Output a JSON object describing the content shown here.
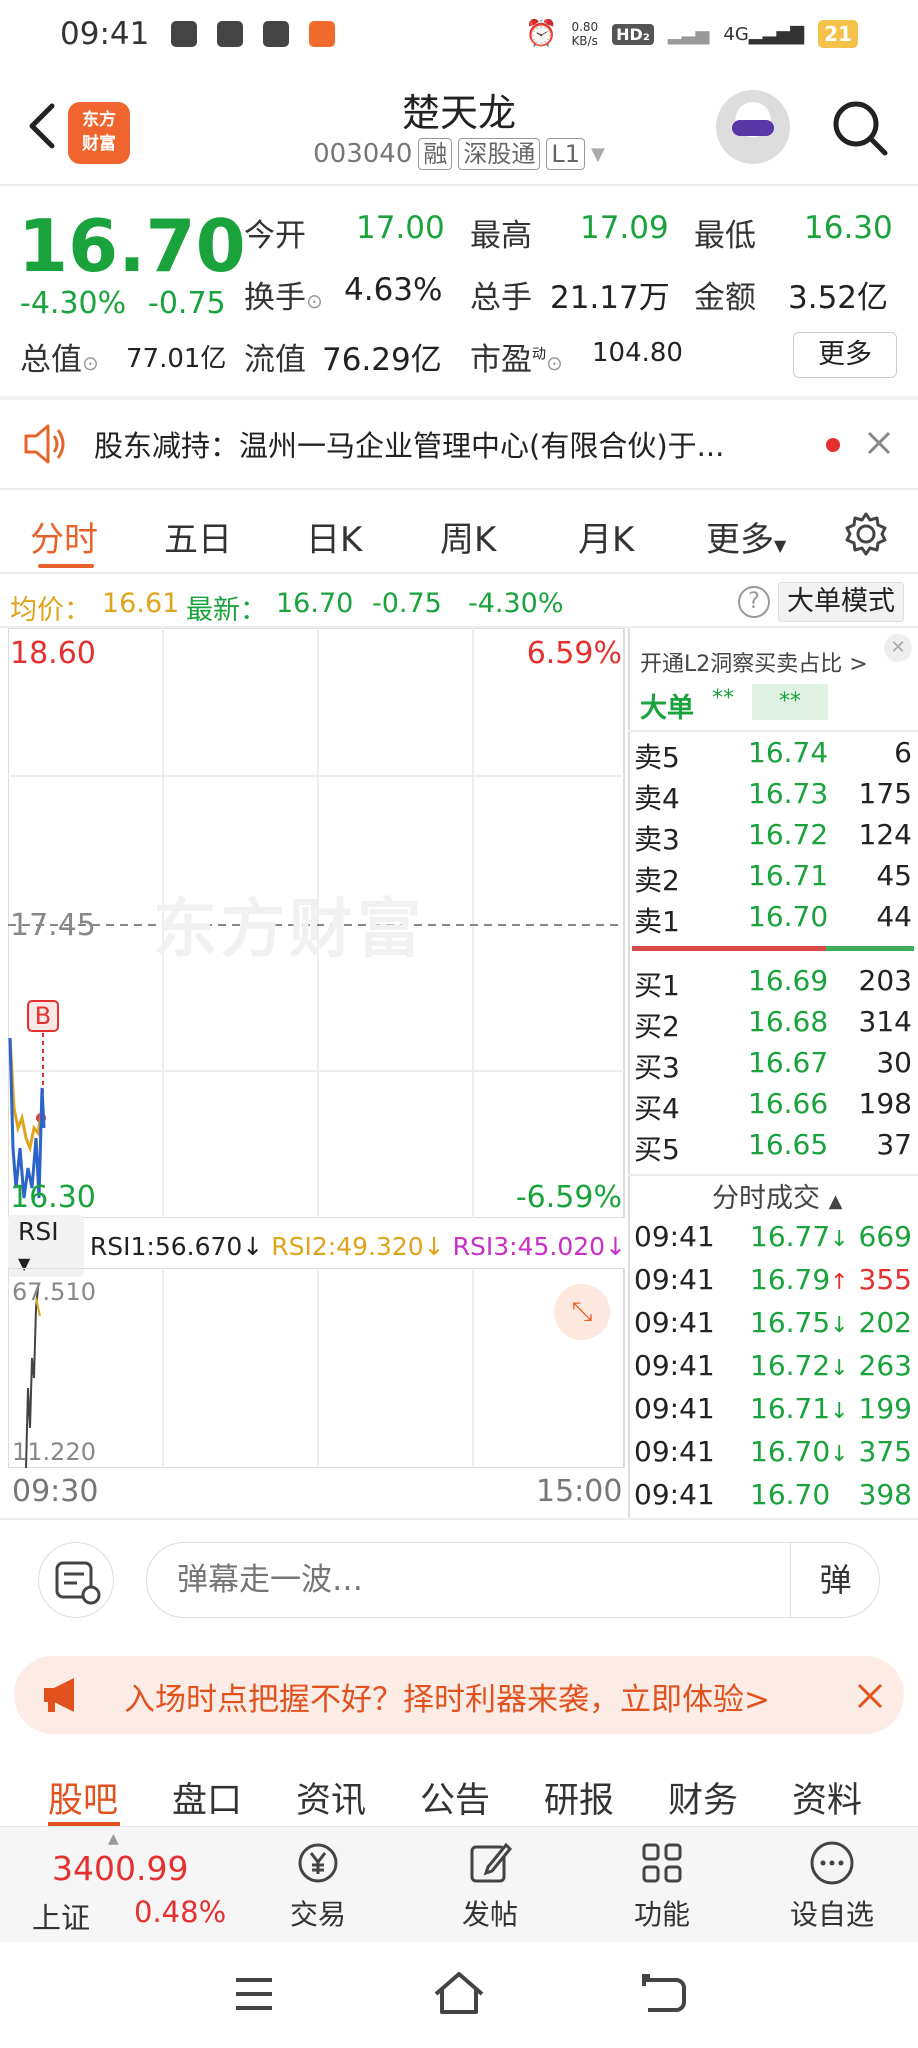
{
  "status": {
    "time": "09:41",
    "net_speed": "0.80\nKB/s",
    "battery": "21"
  },
  "header": {
    "name": "楚天龙",
    "code": "003040",
    "tags": [
      "融",
      "深股通",
      "L1"
    ],
    "logo": "东方\n财富"
  },
  "quote": {
    "price": "16.70",
    "pct": "-4.30%",
    "chg": "-0.75",
    "rows": [
      [
        {
          "l": "今开",
          "v": "17.00",
          "c": "g"
        },
        {
          "l": "最高",
          "v": "17.09",
          "c": "g"
        },
        {
          "l": "最低",
          "v": "16.30",
          "c": "g"
        }
      ],
      [
        {
          "l": "换手",
          "v": "4.63%",
          "c": "b"
        },
        {
          "l": "总手",
          "v": "21.17万",
          "c": "b"
        },
        {
          "l": "金额",
          "v": "3.52亿",
          "c": "b"
        }
      ],
      [
        {
          "l": "总值",
          "v": "77.01亿",
          "c": "b"
        },
        {
          "l": "流值",
          "v": "76.29亿",
          "c": "b"
        },
        {
          "l": "市盈",
          "sup": "动",
          "v": "104.80",
          "c": "b"
        }
      ]
    ],
    "more": "更多"
  },
  "notice": {
    "text": "股东减持：温州一马企业管理中心(有限合伙)于..."
  },
  "tabs": [
    "分时",
    "五日",
    "日K",
    "周K",
    "月K",
    "更多"
  ],
  "avg_line": {
    "avg_label": "均价：",
    "avg": "16.61",
    "last_label": "最新：",
    "last": "16.70",
    "chg": "-0.75",
    "pct": "-4.30%",
    "big_mode": "大单模式"
  },
  "chart": {
    "high": "18.60",
    "high_pct": "6.59%",
    "mid": "17.45",
    "low": "16.30",
    "low_pct": "-6.59%",
    "watermark": "东方财富",
    "b_marker": "B",
    "rsi_label": "RSI",
    "rsi1": "RSI1:56.670↓",
    "rsi2": "RSI2:49.320↓",
    "rsi3": "RSI3:45.020↓",
    "rsi_max": "67.510",
    "rsi_min": "11.220",
    "time_start": "09:30",
    "time_end": "15:00"
  },
  "book": {
    "l2_title": "开通L2洞察买卖占比 >",
    "big_label": "大单",
    "big_val1": "**",
    "big_val2": "**",
    "asks": [
      {
        "l": "卖5",
        "p": "16.74",
        "v": "6"
      },
      {
        "l": "卖4",
        "p": "16.73",
        "v": "175"
      },
      {
        "l": "卖3",
        "p": "16.72",
        "v": "124"
      },
      {
        "l": "卖2",
        "p": "16.71",
        "v": "45"
      },
      {
        "l": "卖1",
        "p": "16.70",
        "v": "44"
      }
    ],
    "bids": [
      {
        "l": "买1",
        "p": "16.69",
        "v": "203"
      },
      {
        "l": "买2",
        "p": "16.68",
        "v": "314"
      },
      {
        "l": "买3",
        "p": "16.67",
        "v": "30"
      },
      {
        "l": "买4",
        "p": "16.66",
        "v": "198"
      },
      {
        "l": "买5",
        "p": "16.65",
        "v": "37"
      }
    ],
    "trades_title": "分时成交",
    "trades": [
      {
        "t": "09:41",
        "p": "16.77",
        "a": "↓",
        "v": "669",
        "c": "g"
      },
      {
        "t": "09:41",
        "p": "16.79",
        "a": "↑",
        "v": "355",
        "c": "r"
      },
      {
        "t": "09:41",
        "p": "16.75",
        "a": "↓",
        "v": "202",
        "c": "g"
      },
      {
        "t": "09:41",
        "p": "16.72",
        "a": "↓",
        "v": "263",
        "c": "g"
      },
      {
        "t": "09:41",
        "p": "16.71",
        "a": "↓",
        "v": "199",
        "c": "g"
      },
      {
        "t": "09:41",
        "p": "16.70",
        "a": "↓",
        "v": "375",
        "c": "g"
      },
      {
        "t": "09:41",
        "p": "16.70",
        "a": "",
        "v": "398",
        "c": "g"
      }
    ]
  },
  "input": {
    "placeholder": "弹幕走一波…",
    "danmu_btn": "弹"
  },
  "promo": {
    "text": "入场时点把握不好？择时利器来袭，立即体验>"
  },
  "bottom_tabs": [
    "股吧",
    "盘口",
    "资讯",
    "公告",
    "研报",
    "财务",
    "资料"
  ],
  "footer": {
    "index_value": "3400.99",
    "index_name": "上证",
    "index_pct": "0.48%",
    "items": [
      "交易",
      "发帖",
      "功能",
      "设自选"
    ]
  },
  "colors": {
    "green": "#1aa33c",
    "red": "#e53030",
    "orange": "#e8632b"
  }
}
